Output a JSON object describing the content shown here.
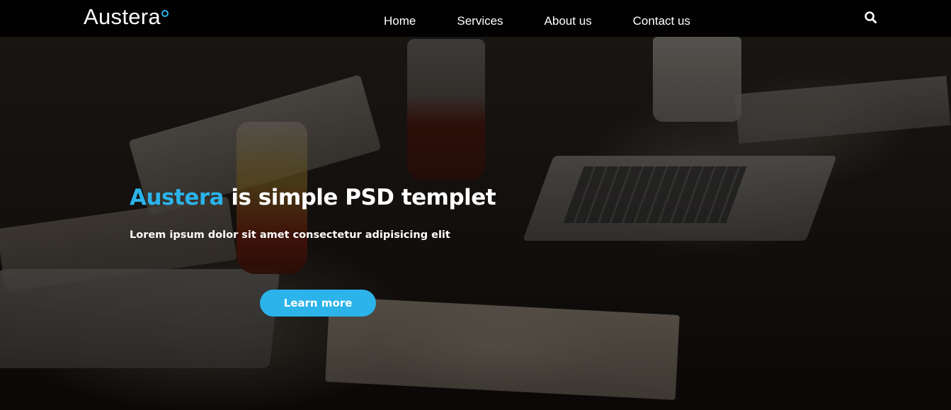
{
  "navbar": {
    "logo_text": "Austera",
    "links": [
      {
        "label": "Home"
      },
      {
        "label": "Services"
      },
      {
        "label": "About us"
      },
      {
        "label": "Contact us"
      }
    ],
    "search_icon": "search-icon"
  },
  "hero": {
    "title_accent": "Austera",
    "title_rest": " is simple PSD templet",
    "subtitle": "Lorem ipsum dolor sit amet consectetur adipisicing elit",
    "cta_label": "Learn more",
    "background_image": "desk-workspace-photo"
  },
  "colors": {
    "accent": "#2bb3ea",
    "navbar_bg": "#000000",
    "text": "#ffffff"
  }
}
